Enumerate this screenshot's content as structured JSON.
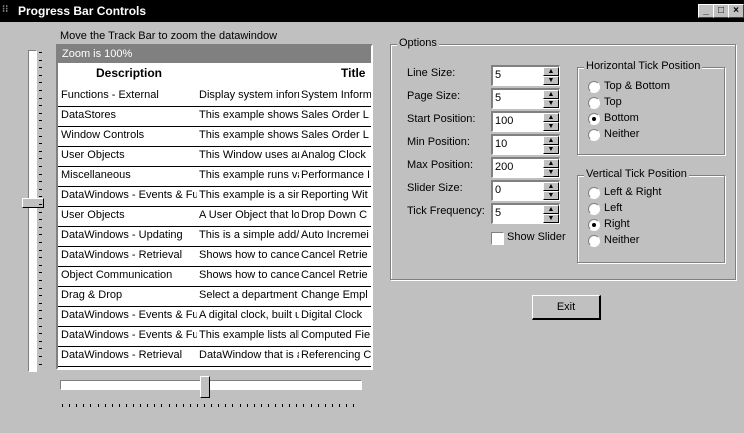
{
  "window": {
    "title": "Progress Bar Controls",
    "icon": "app-icon",
    "buttons": [
      "minimize",
      "maximize",
      "close"
    ]
  },
  "hint": "Move the Track Bar to zoom the datawindow",
  "datawindow": {
    "zoom_label": "Zoom is 100%",
    "columns": [
      "Description",
      "",
      "Title"
    ],
    "rows": [
      {
        "description": "Functions - External",
        "detail": "Display system informa",
        "title": "System Inform"
      },
      {
        "description": "DataStores",
        "detail": "This example shows a",
        "title": "Sales Order L"
      },
      {
        "description": "Window Controls",
        "detail": "This example shows a",
        "title": "Sales Order L"
      },
      {
        "description": "User Objects",
        "detail": "This Window uses an",
        "title": "Analog Clock"
      },
      {
        "description": "Miscellaneous",
        "detail": "This example runs vari",
        "title": "Performance I"
      },
      {
        "description": "DataWindows - Events & Funct",
        "detail": "This example is a simp",
        "title": "Reporting Wit"
      },
      {
        "description": "User Objects",
        "detail": "A User Object that look",
        "title": "Drop Down C"
      },
      {
        "description": "DataWindows - Updating",
        "detail": "This is a simple add/up",
        "title": "Auto Incremei"
      },
      {
        "description": "DataWindows - Retrieval",
        "detail": "Shows how to cancel",
        "title": "Cancel Retrie"
      },
      {
        "description": "Object Communication",
        "detail": "Shows how to cancel",
        "title": "Cancel Retrie"
      },
      {
        "description": "Drag & Drop",
        "detail": "Select a department ar",
        "title": "Change Empl"
      },
      {
        "description": "DataWindows - Events & Funct",
        "detail": "A digital clock, built us",
        "title": "Digital Clock"
      },
      {
        "description": "DataWindows - Events & Funct",
        "detail": "This example lists all ev",
        "title": "Computed Fie"
      },
      {
        "description": "DataWindows - Retrieval",
        "detail": "DataWindow that is a",
        "title": "Referencing C"
      }
    ]
  },
  "options": {
    "group_label": "Options",
    "fields": [
      {
        "label": "Line Size:",
        "value": "5"
      },
      {
        "label": "Page Size:",
        "value": "5"
      },
      {
        "label": "Start Position:",
        "value": "100"
      },
      {
        "label": "Min Position:",
        "value": "10"
      },
      {
        "label": "Max Position:",
        "value": "200"
      },
      {
        "label": "Slider Size:",
        "value": "0"
      },
      {
        "label": "Tick Frequency:",
        "value": "5"
      }
    ],
    "show_slider_label": "Show Slider",
    "show_slider_checked": false
  },
  "horizontal_tick": {
    "group_label": "Horizontal Tick Position",
    "options": [
      "Top & Bottom",
      "Top",
      "Bottom",
      "Neither"
    ],
    "selected": "Bottom"
  },
  "vertical_tick": {
    "group_label": "Vertical Tick Position",
    "options": [
      "Left & Right",
      "Left",
      "Right",
      "Neither"
    ],
    "selected": "Right"
  },
  "exit_label": "Exit"
}
